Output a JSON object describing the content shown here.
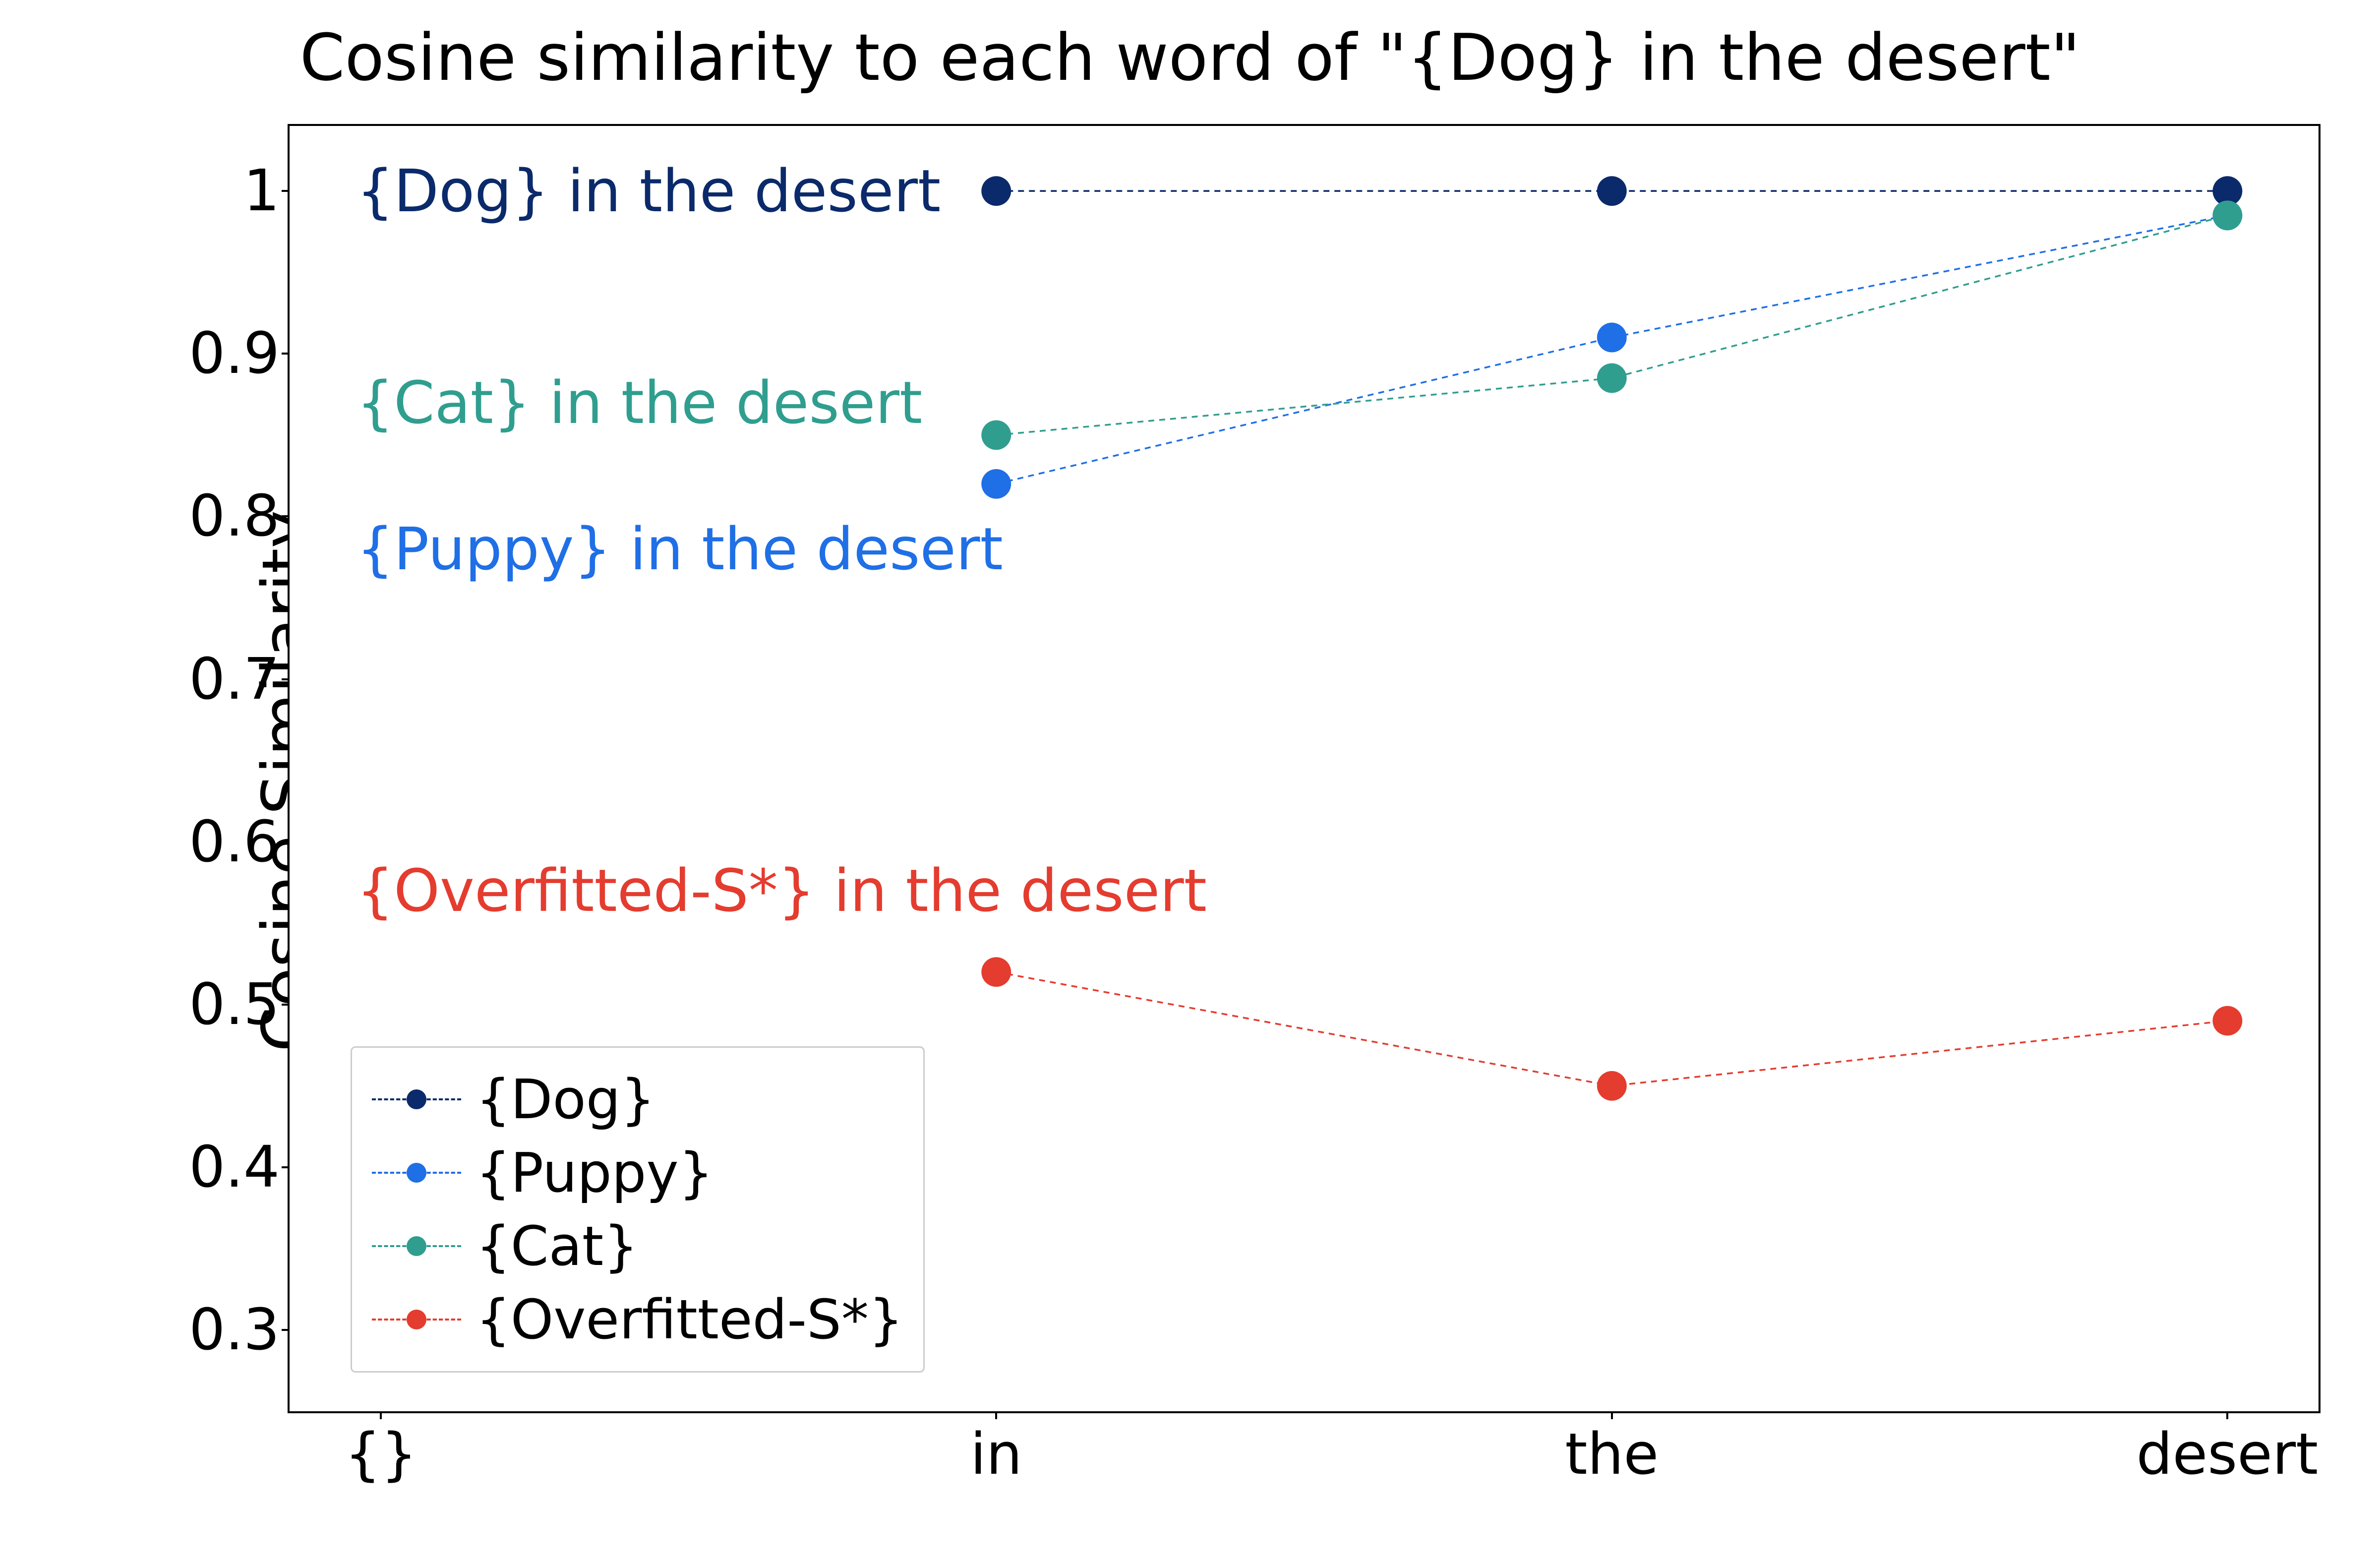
{
  "chart_data": {
    "type": "line",
    "title": "Cosine similarity to each word of \"{Dog} in the desert\"",
    "ylabel": "Cosine Similarity",
    "xlabel": "",
    "categories": [
      "{}",
      "in",
      "the",
      "desert"
    ],
    "x_index_for_values": [
      1,
      2,
      3
    ],
    "ylim": [
      0.25,
      1.04
    ],
    "yticks": [
      0.3,
      0.4,
      0.5,
      0.6,
      0.7,
      0.8,
      0.9,
      1.0
    ],
    "series": [
      {
        "name": "{Dog}",
        "color": "#0b2a6b",
        "values": [
          1.0,
          1.0,
          1.0
        ]
      },
      {
        "name": "{Puppy}",
        "color": "#1f6fe6",
        "values": [
          0.82,
          0.91,
          0.985
        ]
      },
      {
        "name": "{Cat}",
        "color": "#2f9e8f",
        "values": [
          0.85,
          0.885,
          0.985
        ]
      },
      {
        "name": "{Overfitted-S*}",
        "color": "#e43c2f",
        "values": [
          0.52,
          0.45,
          0.49
        ]
      }
    ],
    "annotations": [
      {
        "text": "{Dog} in the desert",
        "color": "#0b2a6b",
        "y": 1.0
      },
      {
        "text": "{Cat} in the desert",
        "color": "#2f9e8f",
        "y": 0.87
      },
      {
        "text": "{Puppy} in the desert",
        "color": "#1f6fe6",
        "y": 0.78
      },
      {
        "text": "{Overfitted-S*} in the desert",
        "color": "#e43c2f",
        "y": 0.57
      }
    ],
    "legend": [
      {
        "label": "{Dog}",
        "color": "#0b2a6b"
      },
      {
        "label": "{Puppy}",
        "color": "#1f6fe6"
      },
      {
        "label": "{Cat}",
        "color": "#2f9e8f"
      },
      {
        "label": "{Overfitted-S*}",
        "color": "#e43c2f"
      }
    ],
    "legend_position": "lower-left"
  }
}
